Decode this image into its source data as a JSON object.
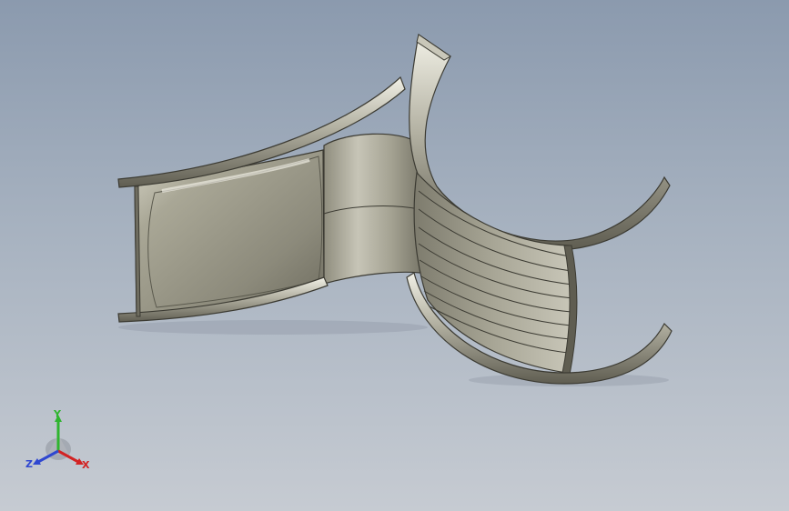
{
  "viewport": {
    "background_top": "#8b9aae",
    "background_bottom": "#c6cbd2",
    "model_color": "#a3a08f"
  },
  "triad": {
    "x_label": "X",
    "y_label": "Y",
    "z_label": "Z",
    "x_color": "#d22323",
    "y_color": "#2fb52f",
    "z_color": "#2f47d0"
  }
}
